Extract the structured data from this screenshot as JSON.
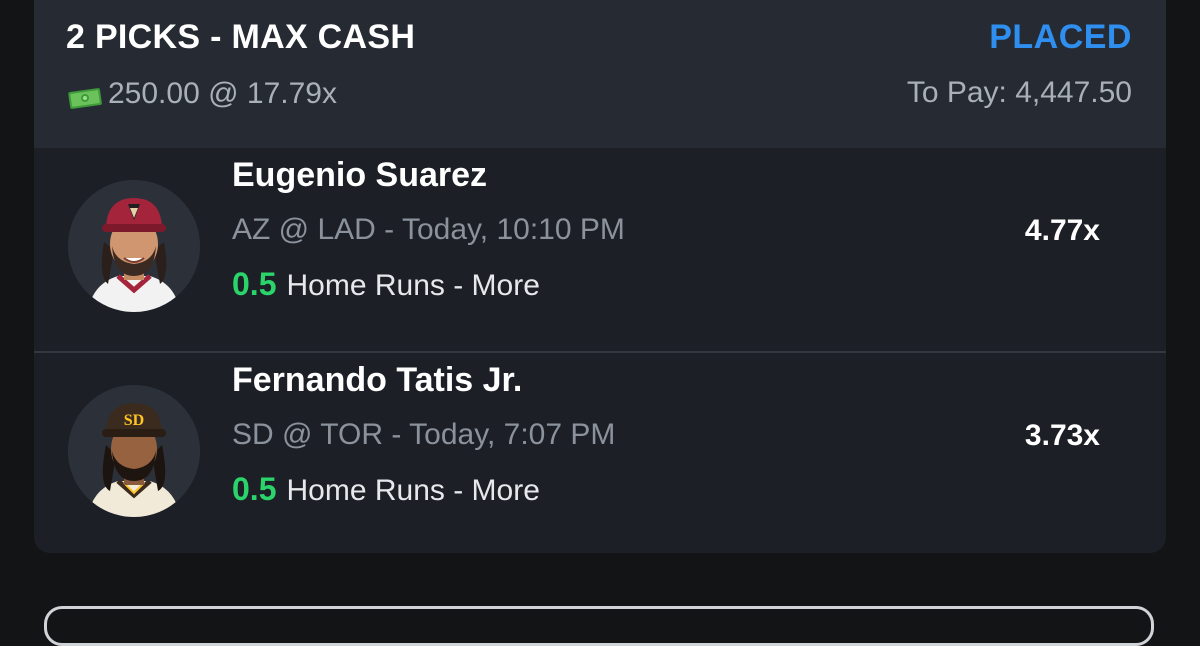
{
  "slip": {
    "title": "2 PICKS - MAX CASH",
    "status": "PLACED",
    "stake": "250.00 @ 17.79x",
    "stake_icon": "money-bill-icon",
    "to_pay": "To Pay: 4,447.50",
    "colors": {
      "status": "#2f8ff0",
      "line_value": "#2bd46a",
      "card": "#1c2026",
      "header": "#262b33",
      "page": "#121416"
    }
  },
  "picks": [
    {
      "player": "Eugenio Suarez",
      "matchup": "AZ @ LAD",
      "time": " - Today, 10:10 PM",
      "line": "0.5",
      "stat": "Home Runs - More",
      "multiplier": "4.77x",
      "avatar_icon": "player-headshot-icon"
    },
    {
      "player": "Fernando Tatis Jr.",
      "matchup": "SD @ TOR",
      "time": " - Today, 7:07 PM",
      "line": "0.5",
      "stat": "Home Runs - More",
      "multiplier": "3.73x",
      "avatar_icon": "player-headshot-icon"
    }
  ]
}
